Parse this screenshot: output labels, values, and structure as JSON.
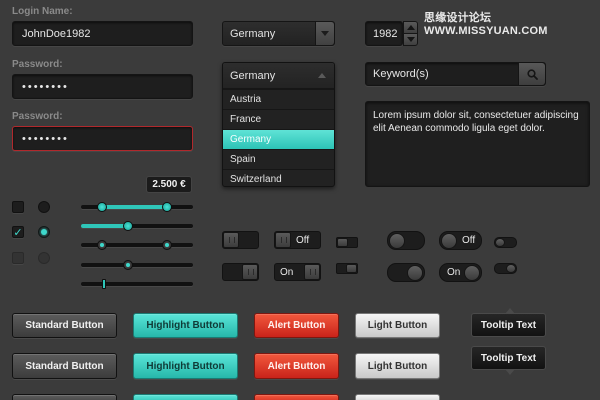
{
  "watermark": "思缘设计论坛  WWW.MISSYUAN.COM",
  "login": {
    "username_label": "Login Name:",
    "username_value": "JohnDoe1982",
    "password_label": "Password:",
    "password_value": "••••••••",
    "password_error_label": "Password:",
    "password_error_value": "••••••••"
  },
  "country_select": {
    "selected": "Germany"
  },
  "country_dropdown": {
    "selected": "Germany",
    "options": [
      "Austria",
      "France",
      "Germany",
      "Spain",
      "Switzerland"
    ],
    "highlighted_index": 2
  },
  "year_stepper": {
    "value": "1982"
  },
  "search": {
    "placeholder": "Keyword(s)"
  },
  "textarea": {
    "value": "Lorem ipsum dolor sit, consectetuer adipiscing elit Aenean commodo ligula eget dolor."
  },
  "slider_value_tooltip": "2.500 €",
  "toggles": {
    "off_label": "Off",
    "on_label": "On"
  },
  "buttons": {
    "standard": "Standard Button",
    "highlight": "Highlight Button",
    "alert": "Alert Button",
    "light": "Light Button"
  },
  "tooltips": {
    "top": "Tooltip Text",
    "bottom": "Tooltip Text"
  },
  "colors": {
    "accent": "#2fc6b9",
    "alert": "#d9301f",
    "background": "#3b3b3b"
  },
  "checkboxes": [
    {
      "checked": false,
      "disabled": false
    },
    {
      "checked": true,
      "disabled": false
    },
    {
      "checked": false,
      "disabled": true
    }
  ],
  "radios": [
    {
      "checked": false,
      "disabled": false
    },
    {
      "checked": true,
      "disabled": false
    },
    {
      "checked": false,
      "disabled": true
    }
  ]
}
